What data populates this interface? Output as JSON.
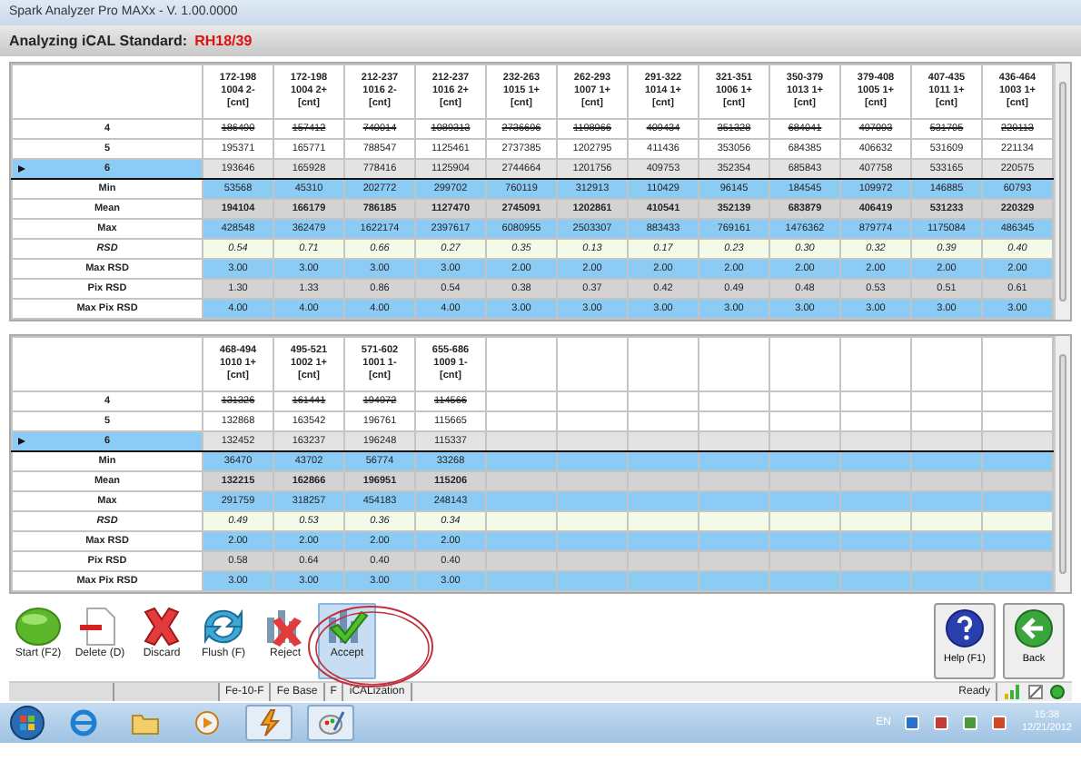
{
  "window": {
    "title": "Spark Analyzer Pro MAXx - V. 1.00.0000"
  },
  "header": {
    "label": "Analyzing iCAL Standard:",
    "standard": "RH18/39"
  },
  "tables": [
    {
      "columns": [
        "172-198\n1004 2-\n[cnt]",
        "172-198\n1004 2+\n[cnt]",
        "212-237\n1016 2-\n[cnt]",
        "212-237\n1016 2+\n[cnt]",
        "232-263\n1015 1+\n[cnt]",
        "262-293\n1007 1+\n[cnt]",
        "291-322\n1014 1+\n[cnt]",
        "321-351\n1006 1+\n[cnt]",
        "350-379\n1013 1+\n[cnt]",
        "379-408\n1005 1+\n[cnt]",
        "407-435\n1011 1+\n[cnt]",
        "436-464\n1003 1+\n[cnt]"
      ],
      "rows": [
        {
          "label": "4",
          "kind": "sample",
          "selected": false,
          "excluded": true,
          "cells": [
            "186490",
            "157412",
            "740014",
            "1089313",
            "2736696",
            "1198966",
            "409434",
            "351328",
            "684041",
            "497093",
            "531705",
            "220113"
          ]
        },
        {
          "label": "5",
          "kind": "sample",
          "selected": false,
          "excluded": false,
          "cells": [
            "195371",
            "165771",
            "788547",
            "1125461",
            "2737385",
            "1202795",
            "411436",
            "353056",
            "684385",
            "406632",
            "531609",
            "221134"
          ]
        },
        {
          "label": "6",
          "kind": "sample",
          "selected": true,
          "excluded": false,
          "cells": [
            "193646",
            "165928",
            "778416",
            "1125904",
            "2744664",
            "1201756",
            "409753",
            "352354",
            "685843",
            "407758",
            "533165",
            "220575"
          ]
        },
        {
          "label": "Min",
          "kind": "min",
          "cells": [
            "53568",
            "45310",
            "202772",
            "299702",
            "760119",
            "312913",
            "110429",
            "96145",
            "184545",
            "109972",
            "146885",
            "60793"
          ]
        },
        {
          "label": "Mean",
          "kind": "mean",
          "cells": [
            "194104",
            "166179",
            "786185",
            "1127470",
            "2745091",
            "1202861",
            "410541",
            "352139",
            "683879",
            "406419",
            "531233",
            "220329"
          ]
        },
        {
          "label": "Max",
          "kind": "max",
          "cells": [
            "428548",
            "362479",
            "1622174",
            "2397617",
            "6080955",
            "2503307",
            "883433",
            "769161",
            "1476362",
            "879774",
            "1175084",
            "486345"
          ]
        },
        {
          "label": "RSD",
          "kind": "rsd",
          "cells": [
            "0.54",
            "0.71",
            "0.66",
            "0.27",
            "0.35",
            "0.13",
            "0.17",
            "0.23",
            "0.30",
            "0.32",
            "0.39",
            "0.40"
          ]
        },
        {
          "label": "Max RSD",
          "kind": "limit",
          "cells": [
            "3.00",
            "3.00",
            "3.00",
            "3.00",
            "2.00",
            "2.00",
            "2.00",
            "2.00",
            "2.00",
            "2.00",
            "2.00",
            "2.00"
          ]
        },
        {
          "label": "Pix RSD",
          "kind": "pix",
          "cells": [
            "1.30",
            "1.33",
            "0.86",
            "0.54",
            "0.38",
            "0.37",
            "0.42",
            "0.49",
            "0.48",
            "0.53",
            "0.51",
            "0.61"
          ]
        },
        {
          "label": "Max Pix RSD",
          "kind": "limit",
          "cells": [
            "4.00",
            "4.00",
            "4.00",
            "4.00",
            "3.00",
            "3.00",
            "3.00",
            "3.00",
            "3.00",
            "3.00",
            "3.00",
            "3.00"
          ]
        }
      ]
    },
    {
      "columns": [
        "468-494\n1010 1+\n[cnt]",
        "495-521\n1002 1+\n[cnt]",
        "571-602\n1001 1-\n[cnt]",
        "655-686\n1009 1-\n[cnt]"
      ],
      "rows": [
        {
          "label": "4",
          "kind": "sample",
          "selected": false,
          "excluded": true,
          "cells": [
            "131326",
            "161441",
            "194972",
            "114566"
          ]
        },
        {
          "label": "5",
          "kind": "sample",
          "selected": false,
          "excluded": false,
          "cells": [
            "132868",
            "163542",
            "196761",
            "115665"
          ]
        },
        {
          "label": "6",
          "kind": "sample",
          "selected": true,
          "excluded": false,
          "cells": [
            "132452",
            "163237",
            "196248",
            "115337"
          ]
        },
        {
          "label": "Min",
          "kind": "min",
          "cells": [
            "36470",
            "43702",
            "56774",
            "33268"
          ]
        },
        {
          "label": "Mean",
          "kind": "mean",
          "cells": [
            "132215",
            "162866",
            "196951",
            "115206"
          ]
        },
        {
          "label": "Max",
          "kind": "max",
          "cells": [
            "291759",
            "318257",
            "454183",
            "248143"
          ]
        },
        {
          "label": "RSD",
          "kind": "rsd",
          "cells": [
            "0.49",
            "0.53",
            "0.36",
            "0.34"
          ]
        },
        {
          "label": "Max RSD",
          "kind": "limit",
          "cells": [
            "2.00",
            "2.00",
            "2.00",
            "2.00"
          ]
        },
        {
          "label": "Pix RSD",
          "kind": "pix",
          "cells": [
            "0.58",
            "0.64",
            "0.40",
            "0.40"
          ]
        },
        {
          "label": "Max Pix RSD",
          "kind": "limit",
          "cells": [
            "3.00",
            "3.00",
            "3.00",
            "3.00"
          ]
        }
      ]
    }
  ],
  "toolbar": [
    {
      "label": "Start (F2)",
      "kind": "start",
      "selected": false
    },
    {
      "label": "Delete (D)",
      "kind": "delete",
      "selected": false
    },
    {
      "label": "Discard",
      "kind": "discard",
      "selected": false
    },
    {
      "label": "Flush (F)",
      "kind": "flush",
      "selected": false
    },
    {
      "label": "Reject",
      "kind": "reject",
      "selected": false
    },
    {
      "label": "Accept",
      "kind": "accept",
      "selected": true
    }
  ],
  "side_buttons": [
    {
      "label": "Help (F1)",
      "kind": "help"
    },
    {
      "label": "Back",
      "kind": "back"
    }
  ],
  "status_bar": {
    "segments": [
      "Fe-10-F",
      "Fe Base",
      "F",
      "iCALization"
    ],
    "status": "Ready"
  },
  "taskbar": {
    "apps": [
      {
        "kind": "browser",
        "selected": false
      },
      {
        "kind": "folder",
        "selected": false
      },
      {
        "kind": "media",
        "selected": false
      },
      {
        "kind": "analyzer",
        "selected": true
      },
      {
        "kind": "paint",
        "selected": true
      }
    ],
    "language": "EN",
    "time": "15:38",
    "date": "12/21/2012"
  }
}
